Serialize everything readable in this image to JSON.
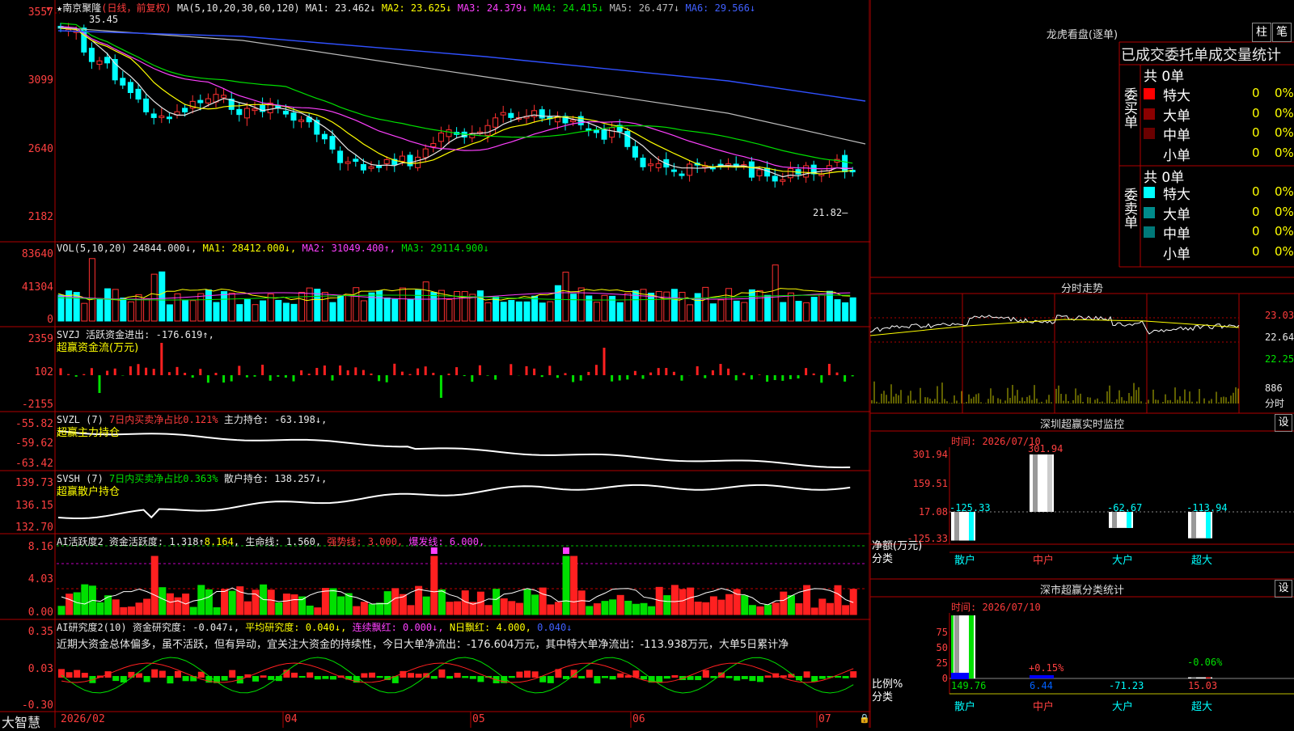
{
  "stock": {
    "name": "南京聚隆",
    "mode": "(日线，前复权)",
    "ma_label": "MA(5,10,20,30,60,120)",
    "ma": [
      {
        "label": "MA1: 23.462↓",
        "color": "#e8e8e8"
      },
      {
        "label": "MA2: 23.625↓",
        "color": "#ffff00"
      },
      {
        "label": "MA3: 24.379↓",
        "color": "#ff40ff"
      },
      {
        "label": "MA4: 24.415↓",
        "color": "#00e000"
      },
      {
        "label": "MA5: 26.477↓",
        "color": "#bbbbbb"
      },
      {
        "label": "MA6: 29.566↓",
        "color": "#4060ff"
      }
    ],
    "high_label": "35.45",
    "low_label": "21.82",
    "price_axis": [
      "3557",
      "3099",
      "2640",
      "2182"
    ]
  },
  "vol": {
    "label": "VOL(5,10,20)",
    "value": "24844.000↓,",
    "ma1": "MA1: 28412.000↓,",
    "ma2": "MA2: 31049.400↑,",
    "ma3": "MA3: 29114.900↓",
    "axis": [
      "83640",
      "41304",
      "0"
    ]
  },
  "svzj": {
    "label": "SVZJ",
    "text": "活跃资金进出: -176.619↑,",
    "sub": "超赢资金流(万元)",
    "axis": [
      "2359",
      "102",
      "-2155"
    ]
  },
  "svzl": {
    "label": "SVZL (7)",
    "ratio": "7日内买卖净占比0.121%",
    "hold": "主力持仓: -63.198↓,",
    "sub": "超赢主力持仓",
    "axis": [
      "-55.82",
      "-59.62",
      "-63.42"
    ]
  },
  "svsh": {
    "label": "SVSH (7)",
    "ratio": "7日内买卖净占比0.363%",
    "hold": "散户持仓: 138.257↓,",
    "sub": "超赢散户持仓",
    "axis": [
      "139.73",
      "136.15",
      "132.70"
    ]
  },
  "ai1": {
    "label": "AI活跃度2",
    "a": "资金活跃度: 1.318↑",
    "b": "8.164",
    "c": "生命线: 1.560",
    "d": "强势线: 3.000",
    "e": "爆发线: 6.000",
    "axis": [
      "8.16",
      "4.03",
      "0.00"
    ]
  },
  "ai2": {
    "label": "AI研究度2(10)",
    "a": "资金研究度: -0.047↓",
    "b": "平均研究度: 0.040↓",
    "c": "连续飘红: 0.000↓",
    "d": "N日飘红: 4.000",
    "e": "0.040↓",
    "comment": "近期大资金总体偏多，虽不活跃，但有异动，宜关注大资金的持续性，今日大单净流出：-176.604万元，其中特大单净流出：-113.938万元，大单5日累计净",
    "axis": [
      "0.35",
      "0.03",
      "-0.30"
    ]
  },
  "timeaxis": {
    "brand": "大智慧",
    "labels": [
      "2026/02",
      "04",
      "05",
      "06",
      "07"
    ]
  },
  "right": {
    "title": "龙虎看盘(逐单)",
    "btn_zhu": "柱",
    "btn_bi": "笔",
    "subtitle": "已成交委托单成交量统计",
    "buy_label": "委买单",
    "sell_label": "委卖单",
    "buy_total": "共 0单",
    "sell_total": "共 0单",
    "buy_rows": [
      {
        "name": "特大",
        "color": "#ff0000",
        "count": "0",
        "pct": "0%"
      },
      {
        "name": "大单",
        "color": "#8b0000",
        "count": "0",
        "pct": "0%"
      },
      {
        "name": "中单",
        "color": "#6b0000",
        "count": "0",
        "pct": "0%"
      },
      {
        "name": "小单",
        "color": "",
        "count": "0",
        "pct": "0%"
      }
    ],
    "sell_rows": [
      {
        "name": "特大",
        "color": "#00ffff",
        "count": "0",
        "pct": "0%"
      },
      {
        "name": "大单",
        "color": "#008b8b",
        "count": "0",
        "pct": "0%"
      },
      {
        "name": "中单",
        "color": "#007878",
        "count": "0",
        "pct": "0%"
      },
      {
        "name": "小单",
        "color": "",
        "count": "0",
        "pct": "0%"
      }
    ],
    "intraday_title": "分时走势",
    "intraday_axis": [
      "23.03",
      "22.64",
      "22.25"
    ],
    "intraday_vol": "886",
    "intraday_vol_unit": "分时"
  },
  "monitor": {
    "title": "深圳超赢实时监控",
    "set": "设",
    "time": "时间: 2026/07/10",
    "axis": [
      "301.94",
      "159.51",
      "17.08",
      "-125.33"
    ],
    "ylabel": "净额(万元)",
    "xlabel": "分类",
    "cats": [
      "散户",
      "中户",
      "大户",
      "超大"
    ],
    "values": [
      "-125.33",
      "301.94",
      "-62.67",
      "-113.94"
    ]
  },
  "classify": {
    "title": "深市超赢分类统计",
    "set": "设",
    "time": "时间: 2026/07/10",
    "axis": [
      "75",
      "50",
      "25",
      "0"
    ],
    "ylabel": "比例%",
    "xlabel": "分类",
    "cats": [
      "散户",
      "中户",
      "大户",
      "超大"
    ],
    "values": [
      "149.76",
      "6.44",
      "-71.23",
      "15.03"
    ],
    "top_labels": [
      "+0.15%",
      "-0.06%"
    ]
  }
}
